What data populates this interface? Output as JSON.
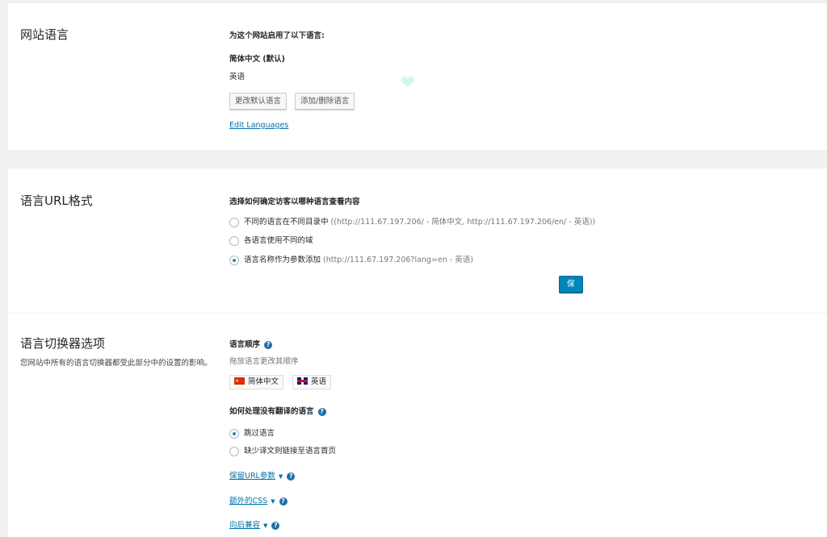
{
  "site_languages": {
    "title": "网站语言",
    "heading": "为这个网站启用了以下语言:",
    "languages": [
      "简体中文 (默认)",
      "英语"
    ],
    "change_default_button": "更改默认语言",
    "add_remove_button": "添加/删除语言",
    "edit_link": "Edit Languages"
  },
  "url_format": {
    "title": "语言URL格式",
    "heading": "选择如何确定访客以哪种语言查看内容",
    "options": [
      {
        "label": "不同的语言在不同目录中",
        "hint": "((http://111.67.197.206/ - 简体中文, http://111.67.197.206/en/ - 英语))",
        "checked": false
      },
      {
        "label": "各语言使用不同的域",
        "hint": "",
        "checked": false
      },
      {
        "label": "语言名称作为参数添加",
        "hint": "(http://111.67.197.206?lang=en - 英语)",
        "checked": true
      }
    ],
    "save_button": "保存"
  },
  "switcher": {
    "title": "语言切换器选项",
    "description": "您网站中所有的语言切换器都受此部分中的设置的影响。",
    "order_heading": "语言顺序",
    "order_hint": "拖放语言更改其顺序",
    "order_languages": [
      {
        "name": "简体中文",
        "flag": "cn-flag-icon"
      },
      {
        "name": "英语",
        "flag": "gb-flag-icon"
      }
    ],
    "untranslated_heading": "如何处理没有翻译的语言",
    "untranslated_options": [
      {
        "label": "跳过语言",
        "checked": true
      },
      {
        "label": "缺少译文则链接至语言首页",
        "checked": false
      }
    ],
    "expanders": [
      "保留URL参数",
      "额外的CSS",
      "向后兼容"
    ]
  },
  "colors": {
    "primary": "#0085ba",
    "link": "#0073aa",
    "background": "#f1f1f1"
  }
}
